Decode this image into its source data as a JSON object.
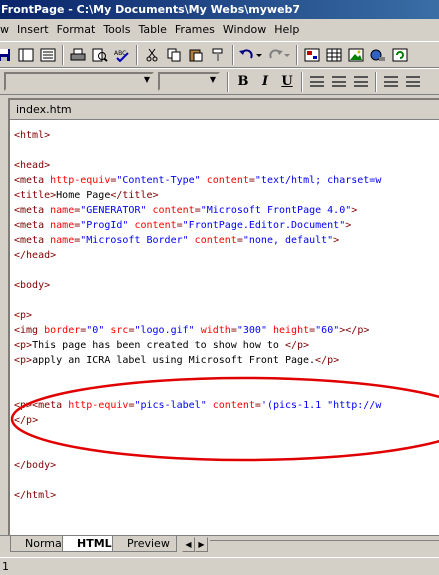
{
  "window": {
    "title": "FrontPage - C:\\My Documents\\My Webs\\myweb7"
  },
  "menu": [
    {
      "mnemonic": "",
      "rest": "w"
    },
    {
      "mnemonic": "I",
      "rest": "nsert"
    },
    {
      "mnemonic": "F",
      "rest": "o",
      "label": "Format"
    },
    {
      "mnemonic": "T",
      "rest": "ools"
    },
    {
      "mnemonic": "T",
      "rest": "able"
    },
    {
      "mnemonic": "F",
      "rest": "rames"
    },
    {
      "mnemonic": "W",
      "rest": "indow"
    },
    {
      "mnemonic": "H",
      "rest": "elp"
    }
  ],
  "menu_labels": [
    "w",
    "Insert",
    "Format",
    "Tools",
    "Table",
    "Frames",
    "Window",
    "Help"
  ],
  "format_buttons": {
    "bold": "B",
    "italic": "I",
    "underline": "U"
  },
  "document": {
    "tab_label": "index.htm"
  },
  "code_lines": [
    "<html>",
    "",
    "<head>",
    "<meta http-equiv=\"Content-Type\" content=\"text/html; charset=w",
    "<title>Home Page</title>",
    "<meta name=\"GENERATOR\" content=\"Microsoft FrontPage 4.0\">",
    "<meta name=\"ProgId\" content=\"FrontPage.Editor.Document\">",
    "<meta name=\"Microsoft Border\" content=\"none, default\">",
    "</head>",
    "",
    "<body>",
    "",
    "<p>",
    "<img border=\"0\" src=\"logo.gif\" width=\"300\" height=\"60\"></p>",
    "<p>This page has been created to show how to </p>",
    "<p>apply an ICRA label using Microsoft Front Page.</p>",
    "",
    "",
    "<p><meta http-equiv=\"pics-label\" content='(pics-1.1 \"http://w",
    "</p>",
    "",
    "",
    "</body>",
    "",
    "</html>"
  ],
  "view_tabs": [
    "Normal",
    "HTML",
    "Preview"
  ],
  "active_view_tab": "HTML",
  "status": {
    "left": "1"
  },
  "colors": {
    "title_bar": "#0a246a",
    "tag": "#800000",
    "attribute": "#ff0000",
    "value": "#0000ff",
    "annotation_ellipse": "#e00000"
  }
}
